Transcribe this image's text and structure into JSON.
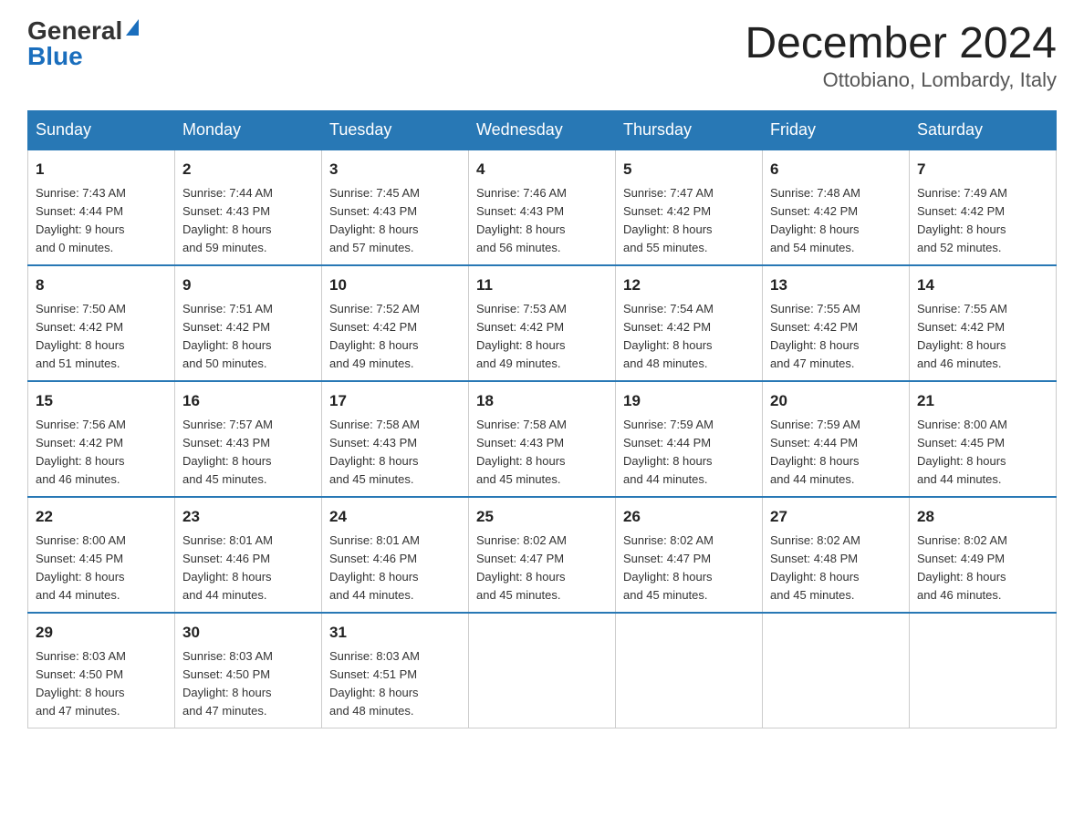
{
  "logo": {
    "general": "General",
    "blue": "Blue"
  },
  "title": "December 2024",
  "location": "Ottobiano, Lombardy, Italy",
  "days_of_week": [
    "Sunday",
    "Monday",
    "Tuesday",
    "Wednesday",
    "Thursday",
    "Friday",
    "Saturday"
  ],
  "weeks": [
    [
      {
        "day": "1",
        "sunrise": "7:43 AM",
        "sunset": "4:44 PM",
        "daylight_h": "9",
        "daylight_m": "0"
      },
      {
        "day": "2",
        "sunrise": "7:44 AM",
        "sunset": "4:43 PM",
        "daylight_h": "8",
        "daylight_m": "59"
      },
      {
        "day": "3",
        "sunrise": "7:45 AM",
        "sunset": "4:43 PM",
        "daylight_h": "8",
        "daylight_m": "57"
      },
      {
        "day": "4",
        "sunrise": "7:46 AM",
        "sunset": "4:43 PM",
        "daylight_h": "8",
        "daylight_m": "56"
      },
      {
        "day": "5",
        "sunrise": "7:47 AM",
        "sunset": "4:42 PM",
        "daylight_h": "8",
        "daylight_m": "55"
      },
      {
        "day": "6",
        "sunrise": "7:48 AM",
        "sunset": "4:42 PM",
        "daylight_h": "8",
        "daylight_m": "54"
      },
      {
        "day": "7",
        "sunrise": "7:49 AM",
        "sunset": "4:42 PM",
        "daylight_h": "8",
        "daylight_m": "52"
      }
    ],
    [
      {
        "day": "8",
        "sunrise": "7:50 AM",
        "sunset": "4:42 PM",
        "daylight_h": "8",
        "daylight_m": "51"
      },
      {
        "day": "9",
        "sunrise": "7:51 AM",
        "sunset": "4:42 PM",
        "daylight_h": "8",
        "daylight_m": "50"
      },
      {
        "day": "10",
        "sunrise": "7:52 AM",
        "sunset": "4:42 PM",
        "daylight_h": "8",
        "daylight_m": "49"
      },
      {
        "day": "11",
        "sunrise": "7:53 AM",
        "sunset": "4:42 PM",
        "daylight_h": "8",
        "daylight_m": "49"
      },
      {
        "day": "12",
        "sunrise": "7:54 AM",
        "sunset": "4:42 PM",
        "daylight_h": "8",
        "daylight_m": "48"
      },
      {
        "day": "13",
        "sunrise": "7:55 AM",
        "sunset": "4:42 PM",
        "daylight_h": "8",
        "daylight_m": "47"
      },
      {
        "day": "14",
        "sunrise": "7:55 AM",
        "sunset": "4:42 PM",
        "daylight_h": "8",
        "daylight_m": "46"
      }
    ],
    [
      {
        "day": "15",
        "sunrise": "7:56 AM",
        "sunset": "4:42 PM",
        "daylight_h": "8",
        "daylight_m": "46"
      },
      {
        "day": "16",
        "sunrise": "7:57 AM",
        "sunset": "4:43 PM",
        "daylight_h": "8",
        "daylight_m": "45"
      },
      {
        "day": "17",
        "sunrise": "7:58 AM",
        "sunset": "4:43 PM",
        "daylight_h": "8",
        "daylight_m": "45"
      },
      {
        "day": "18",
        "sunrise": "7:58 AM",
        "sunset": "4:43 PM",
        "daylight_h": "8",
        "daylight_m": "45"
      },
      {
        "day": "19",
        "sunrise": "7:59 AM",
        "sunset": "4:44 PM",
        "daylight_h": "8",
        "daylight_m": "44"
      },
      {
        "day": "20",
        "sunrise": "7:59 AM",
        "sunset": "4:44 PM",
        "daylight_h": "8",
        "daylight_m": "44"
      },
      {
        "day": "21",
        "sunrise": "8:00 AM",
        "sunset": "4:45 PM",
        "daylight_h": "8",
        "daylight_m": "44"
      }
    ],
    [
      {
        "day": "22",
        "sunrise": "8:00 AM",
        "sunset": "4:45 PM",
        "daylight_h": "8",
        "daylight_m": "44"
      },
      {
        "day": "23",
        "sunrise": "8:01 AM",
        "sunset": "4:46 PM",
        "daylight_h": "8",
        "daylight_m": "44"
      },
      {
        "day": "24",
        "sunrise": "8:01 AM",
        "sunset": "4:46 PM",
        "daylight_h": "8",
        "daylight_m": "44"
      },
      {
        "day": "25",
        "sunrise": "8:02 AM",
        "sunset": "4:47 PM",
        "daylight_h": "8",
        "daylight_m": "45"
      },
      {
        "day": "26",
        "sunrise": "8:02 AM",
        "sunset": "4:47 PM",
        "daylight_h": "8",
        "daylight_m": "45"
      },
      {
        "day": "27",
        "sunrise": "8:02 AM",
        "sunset": "4:48 PM",
        "daylight_h": "8",
        "daylight_m": "45"
      },
      {
        "day": "28",
        "sunrise": "8:02 AM",
        "sunset": "4:49 PM",
        "daylight_h": "8",
        "daylight_m": "46"
      }
    ],
    [
      {
        "day": "29",
        "sunrise": "8:03 AM",
        "sunset": "4:50 PM",
        "daylight_h": "8",
        "daylight_m": "47"
      },
      {
        "day": "30",
        "sunrise": "8:03 AM",
        "sunset": "4:50 PM",
        "daylight_h": "8",
        "daylight_m": "47"
      },
      {
        "day": "31",
        "sunrise": "8:03 AM",
        "sunset": "4:51 PM",
        "daylight_h": "8",
        "daylight_m": "48"
      },
      null,
      null,
      null,
      null
    ]
  ]
}
